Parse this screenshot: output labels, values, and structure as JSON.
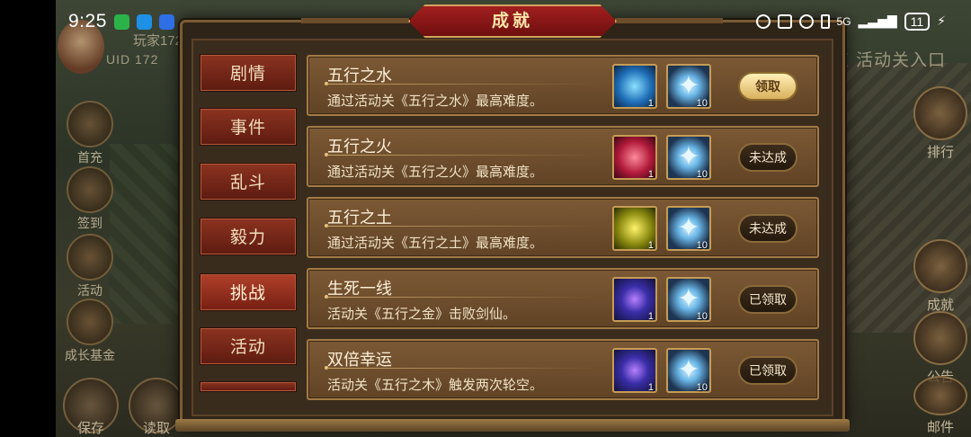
{
  "status_bar": {
    "time": "9:25",
    "battery": "11",
    "signal": "5G"
  },
  "player": {
    "name": "玩家172",
    "uid": "UID 172"
  },
  "background": {
    "left_menu": [
      "首充",
      "签到",
      "活动",
      "成长基金"
    ],
    "right_menu": [
      "排行",
      "成就",
      "公告",
      "邮件"
    ],
    "event_entry": "东 活动关入口",
    "bottom_buttons": [
      "保存",
      "读取"
    ]
  },
  "dialog": {
    "title": "成就",
    "tabs": [
      {
        "label": "剧情",
        "active": false
      },
      {
        "label": "事件",
        "active": false
      },
      {
        "label": "乱斗",
        "active": false
      },
      {
        "label": "毅力",
        "active": false
      },
      {
        "label": "挑战",
        "active": true
      },
      {
        "label": "活动",
        "active": false
      }
    ],
    "achievements": [
      {
        "title": "五行之水",
        "desc": "通过活动关《五行之水》最高难度。",
        "reward1": {
          "icon": "water-figure-icon",
          "count": "1"
        },
        "reward2": {
          "icon": "ice-crystal-icon",
          "count": "10"
        },
        "button": "领取",
        "state": "claimable"
      },
      {
        "title": "五行之火",
        "desc": "通过活动关《五行之火》最高难度。",
        "reward1": {
          "icon": "fire-figure-icon",
          "count": "1"
        },
        "reward2": {
          "icon": "ice-crystal-icon",
          "count": "10"
        },
        "button": "未达成",
        "state": "locked"
      },
      {
        "title": "五行之土",
        "desc": "通过活动关《五行之土》最高难度。",
        "reward1": {
          "icon": "earth-figure-icon",
          "count": "1"
        },
        "reward2": {
          "icon": "ice-crystal-icon",
          "count": "10"
        },
        "button": "未达成",
        "state": "locked"
      },
      {
        "title": "生死一线",
        "desc": "活动关《五行之金》击败剑仙。",
        "reward1": {
          "icon": "swirl-orb-icon",
          "count": "1"
        },
        "reward2": {
          "icon": "ice-crystal-icon",
          "count": "10"
        },
        "button": "已领取",
        "state": "claimed"
      },
      {
        "title": "双倍幸运",
        "desc": "活动关《五行之木》触发两次轮空。",
        "reward1": {
          "icon": "swirl-orb-icon",
          "count": "1"
        },
        "reward2": {
          "icon": "ice-crystal-icon",
          "count": "10"
        },
        "button": "已领取",
        "state": "claimed"
      }
    ]
  }
}
